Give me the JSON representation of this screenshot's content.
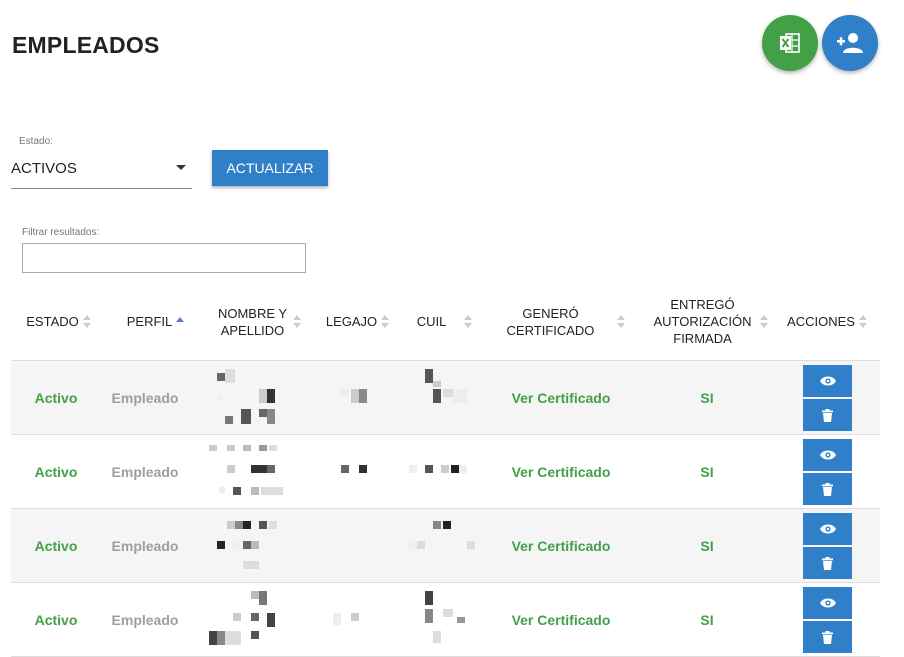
{
  "page": {
    "title": "EMPLEADOS"
  },
  "actions": {
    "export_icon": "excel-icon",
    "add_icon": "add-user-icon"
  },
  "filters": {
    "estado_label": "Estado:",
    "estado_value": "ACTIVOS",
    "update_label": "ACTUALIZAR",
    "filter_label": "Filtrar resultados:",
    "filter_value": ""
  },
  "table": {
    "columns": [
      "ESTADO",
      "PERFIL",
      "NOMBRE Y APELLIDO",
      "LEGAJO",
      "CUIL",
      "GENERÓ CERTIFICADO",
      "ENTREGÓ AUTORIZACIÓN FIRMADA",
      "ACCIONES"
    ],
    "sorted_column": "PERFIL",
    "rows": [
      {
        "estado": "Activo",
        "perfil": "Empleado",
        "certificado": "Ver Certificado",
        "autorizacion": "SI"
      },
      {
        "estado": "Activo",
        "perfil": "Empleado",
        "certificado": "Ver Certificado",
        "autorizacion": "SI"
      },
      {
        "estado": "Activo",
        "perfil": "Empleado",
        "certificado": "Ver Certificado",
        "autorizacion": "SI"
      },
      {
        "estado": "Activo",
        "perfil": "Empleado",
        "certificado": "Ver Certificado",
        "autorizacion": "SI"
      }
    ],
    "row_actions": {
      "view_icon": "eye-icon",
      "delete_icon": "trash-icon"
    }
  },
  "colors": {
    "primary": "#2f80c8",
    "success": "#43a047",
    "muted": "#9e9e9e"
  }
}
